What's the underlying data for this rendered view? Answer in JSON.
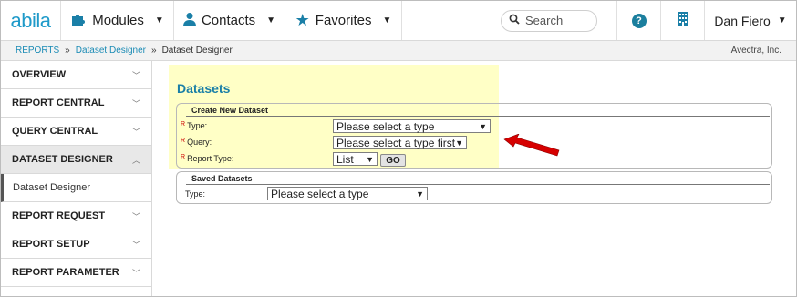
{
  "app": {
    "logo": "abila"
  },
  "nav": {
    "modules": "Modules",
    "contacts": "Contacts",
    "favorites": "Favorites",
    "search_placeholder": "Search",
    "help": "?",
    "user": "Dan Fiero"
  },
  "breadcrumb": {
    "items": [
      "REPORTS",
      "Dataset Designer",
      "Dataset Designer"
    ],
    "separator": "»",
    "organization": "Avectra, Inc."
  },
  "sidebar": {
    "items": [
      {
        "label": "OVERVIEW"
      },
      {
        "label": "REPORT CENTRAL"
      },
      {
        "label": "QUERY CENTRAL"
      },
      {
        "label": "DATASET DESIGNER"
      },
      {
        "label": "Dataset Designer"
      },
      {
        "label": "REPORT REQUEST"
      },
      {
        "label": "REPORT SETUP"
      },
      {
        "label": "REPORT PARAMETER"
      }
    ]
  },
  "main": {
    "title": "Datasets",
    "create": {
      "legend": "Create New Dataset",
      "required_mark": "R",
      "type_label": "Type:",
      "type_value": "Please select a type",
      "query_label": "Query:",
      "query_value": "Please select a type first",
      "report_type_label": "Report Type:",
      "report_type_value": "List",
      "go_label": "GO"
    },
    "saved": {
      "legend": "Saved Datasets",
      "type_label": "Type:",
      "type_value": "Please select a type"
    }
  },
  "colors": {
    "accent": "#1a7fa7",
    "highlight": "#ffffc6",
    "arrow": "#d60000",
    "required": "#cc0000"
  }
}
